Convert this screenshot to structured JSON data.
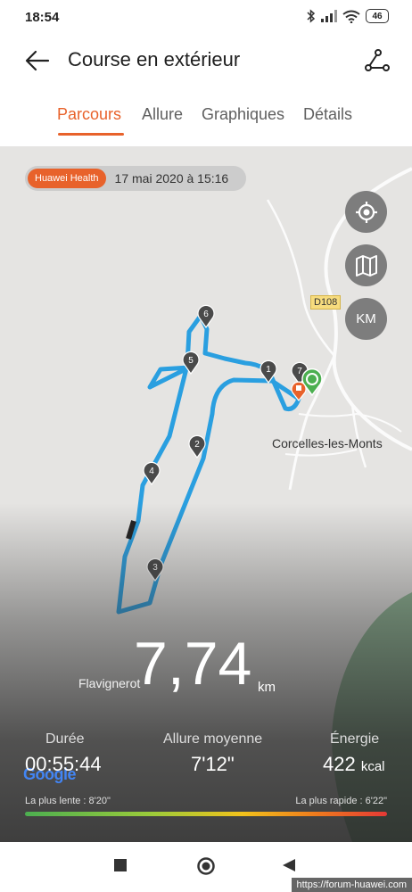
{
  "status_bar": {
    "time": "18:54",
    "battery": "46"
  },
  "header": {
    "title": "Course en extérieur"
  },
  "tabs": [
    {
      "label": "Parcours",
      "active": true
    },
    {
      "label": "Allure",
      "active": false
    },
    {
      "label": "Graphiques",
      "active": false
    },
    {
      "label": "Détails",
      "active": false
    }
  ],
  "map": {
    "source_badge": "Huawei Health",
    "date_time": "17 mai 2020 à 15:16",
    "road_label": "D108",
    "places": [
      "Corcelles-les-Monts",
      "Flavignerot"
    ],
    "unit_toggle": "KM",
    "attribution": "Google",
    "route_color": "#2a9fe0",
    "km_markers": [
      "1",
      "2",
      "3",
      "4",
      "5",
      "6",
      "7"
    ]
  },
  "stats": {
    "distance_value": "7,74",
    "distance_unit": "km",
    "duration_label": "Durée",
    "duration_value": "00:55:44",
    "pace_label": "Allure moyenne",
    "pace_value": "7'12\"",
    "energy_label": "Énergie",
    "energy_value": "422",
    "energy_unit": "kcal",
    "slowest_pace": "La plus lente : 8'20\"",
    "fastest_pace": "La plus rapide : 6'22\""
  },
  "watermark": "https://forum-huawei.com",
  "colors": {
    "accent": "#e8622b",
    "map_background": "#e5e4e2"
  }
}
